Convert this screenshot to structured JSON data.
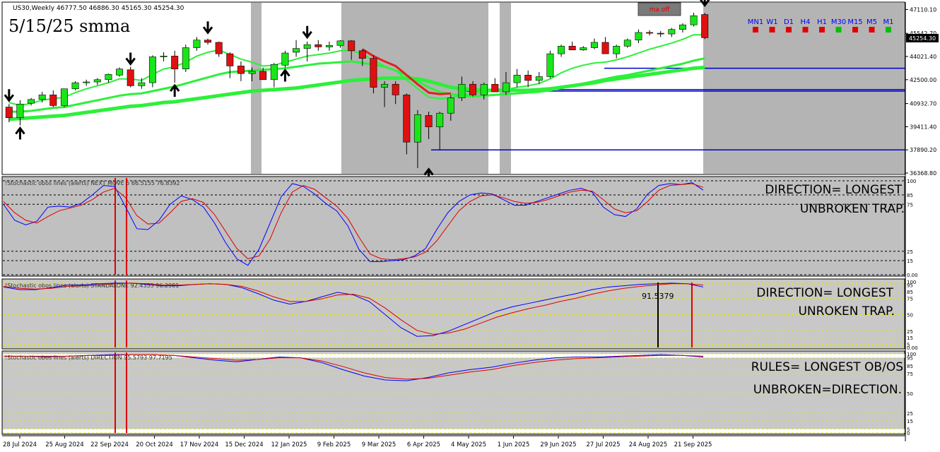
{
  "symbol_info": "US30,Weekly  46777.50 46886.30 45165.30 45254.30",
  "overlay_title": "5/15/25 smma",
  "ma_status_label": "ma off",
  "current_price_label": "45254.30",
  "timeframes": [
    {
      "label": "MN1",
      "color": "#e00000"
    },
    {
      "label": "W1",
      "color": "#e00000"
    },
    {
      "label": "D1",
      "color": "#e00000"
    },
    {
      "label": "H4",
      "color": "#e00000"
    },
    {
      "label": "H1",
      "color": "#e00000"
    },
    {
      "label": "M30",
      "color": "#00c000"
    },
    {
      "label": "M15",
      "color": "#e00000"
    },
    {
      "label": "M5",
      "color": "#e00000"
    },
    {
      "label": "M1",
      "color": "#00c000"
    }
  ],
  "x_axis_labels": [
    "28 Jul 2024",
    "25 Aug 2024",
    "22 Sep 2024",
    "20 Oct 2024",
    "17 Nov 2024",
    "15 Dec 2024",
    "12 Jan 2025",
    "9 Feb 2025",
    "9 Mar 2025",
    "6 Apr 2025",
    "4 May 2025",
    "1 Jun 2025",
    "29 Jun 2025",
    "27 Jul 2025",
    "24 Aug 2025",
    "21 Sep 2025"
  ],
  "subwindows": [
    {
      "label": "!Stochastic obos lines (alerts) NEXT MOVE 5 66.5155 76.8392",
      "note_lines": [
        "DIRECTION= LONGEST",
        "UNBROKEN TRAP."
      ],
      "levels": [
        "100",
        "85",
        "75",
        "25",
        "15",
        "0.00"
      ],
      "extra_levels": []
    },
    {
      "label": "!Stochastic obos lines (alerts) STANDALONE 92.4355 96.2981",
      "note_lines": [
        "DIRECTION= LONGEST",
        "UNROKEN TRAP."
      ],
      "levels": [
        "100",
        "95",
        "85",
        "75",
        "50",
        "25",
        "15",
        "5",
        "0.00"
      ],
      "extra_levels": [
        "99.5",
        "95"
      ],
      "annotation": "91.5379"
    },
    {
      "label": "!Stochastic obos lines (alerts) DIRECTION 95.5793 97.7195",
      "note_lines": [
        "RULES= LONGEST OB/OS",
        "UNBROKEN=DIRECTION."
      ],
      "levels": [
        "100",
        "95",
        "85",
        "75",
        "50",
        "25",
        "15",
        "5",
        "0"
      ],
      "extra_levels": []
    }
  ],
  "chart_data": [
    {
      "type": "candlestick",
      "title": "US30,Weekly",
      "ylim": [
        36368.8,
        47500
      ],
      "y_ticks": [
        "47110.10",
        "45542.70",
        "44021.40",
        "42500.00",
        "40932.70",
        "39411.40",
        "37890.20",
        "36368.80"
      ],
      "candles": [
        [
          40700,
          40900,
          39700,
          40000
        ],
        [
          40000,
          41150,
          39500,
          40900
        ],
        [
          40950,
          41300,
          40800,
          41200
        ],
        [
          41200,
          41700,
          41000,
          41500
        ],
        [
          41500,
          41800,
          40700,
          40800
        ],
        [
          40800,
          41900,
          40700,
          41900
        ],
        [
          41900,
          42400,
          41800,
          42300
        ],
        [
          42300,
          42500,
          42100,
          42350
        ],
        [
          42350,
          42600,
          42150,
          42500
        ],
        [
          42500,
          42900,
          42300,
          42850
        ],
        [
          42800,
          43300,
          42700,
          43200
        ],
        [
          43150,
          43350,
          42000,
          42100
        ],
        [
          42100,
          42600,
          41900,
          42300
        ],
        [
          42300,
          44100,
          42000,
          44000
        ],
        [
          44000,
          44300,
          43700,
          44050
        ],
        [
          44050,
          44400,
          42300,
          43200
        ],
        [
          43200,
          44800,
          43000,
          44600
        ],
        [
          44600,
          45300,
          44400,
          45100
        ],
        [
          45100,
          45200,
          44800,
          44950
        ],
        [
          44950,
          45000,
          44000,
          44200
        ],
        [
          44200,
          44300,
          42600,
          43400
        ],
        [
          43400,
          43700,
          42400,
          42900
        ],
        [
          42900,
          43300,
          42400,
          43050
        ],
        [
          43050,
          43300,
          42500,
          42500
        ],
        [
          42500,
          43600,
          42000,
          43500
        ],
        [
          43450,
          44400,
          43300,
          44250
        ],
        [
          44300,
          45100,
          44000,
          44550
        ],
        [
          44550,
          45000,
          43700,
          44800
        ],
        [
          44800,
          45100,
          44400,
          44650
        ],
        [
          44650,
          45000,
          44400,
          44750
        ],
        [
          44750,
          45100,
          44600,
          45050
        ],
        [
          45050,
          45100,
          43800,
          44400
        ],
        [
          44400,
          44500,
          43400,
          43900
        ],
        [
          43900,
          44100,
          41600,
          42000
        ],
        [
          42000,
          42400,
          40700,
          42200
        ],
        [
          42200,
          42400,
          40900,
          41500
        ],
        [
          41500,
          41600,
          37600,
          38400
        ],
        [
          38400,
          40500,
          36700,
          40200
        ],
        [
          40150,
          40400,
          38600,
          39400
        ],
        [
          39400,
          40400,
          37900,
          40300
        ],
        [
          40300,
          41500,
          39800,
          41300
        ],
        [
          41300,
          42700,
          41100,
          42200
        ],
        [
          42200,
          42400,
          41400,
          41500
        ],
        [
          41500,
          42300,
          41200,
          42200
        ],
        [
          42200,
          42600,
          41700,
          41700
        ],
        [
          41700,
          43000,
          41500,
          42300
        ],
        [
          42300,
          43200,
          42000,
          42800
        ],
        [
          42800,
          43100,
          42000,
          42450
        ],
        [
          42450,
          43000,
          42200,
          42700
        ],
        [
          42700,
          44400,
          42600,
          44200
        ],
        [
          44200,
          44800,
          44000,
          44700
        ],
        [
          44700,
          45000,
          44500,
          44450
        ],
        [
          44450,
          44700,
          44400,
          44600
        ],
        [
          44600,
          45200,
          44500,
          44950
        ],
        [
          44950,
          45300,
          44200,
          44200
        ],
        [
          44200,
          44800,
          43900,
          44700
        ],
        [
          44700,
          45200,
          44600,
          45100
        ],
        [
          45100,
          45800,
          44900,
          45600
        ],
        [
          45600,
          45750,
          45400,
          45550
        ],
        [
          45550,
          45700,
          45300,
          45500
        ],
        [
          45500,
          45900,
          45300,
          45800
        ],
        [
          45800,
          46200,
          45600,
          46100
        ],
        [
          46100,
          46900,
          46000,
          46700
        ],
        [
          46777.5,
          46886.3,
          45165.3,
          45254.3
        ]
      ],
      "smma_5": [
        41000,
        40800,
        40950,
        41150,
        41250,
        41350,
        41650,
        41900,
        42100,
        42300,
        42550,
        42550,
        42450,
        42850,
        43200,
        43350,
        43650,
        44050,
        44300,
        44450,
        44150,
        43850,
        43650,
        43400,
        43450,
        43650,
        43850,
        44050,
        44150,
        44250,
        44400,
        44400,
        44200,
        43750,
        43400,
        43100,
        42500,
        41900,
        41350,
        41250,
        41300,
        41500,
        41600,
        41650,
        41800,
        41850,
        42000,
        42100,
        42250,
        42550,
        42950,
        43250,
        43450,
        43600,
        43650,
        43800,
        44000,
        44250,
        44500,
        44700,
        44900,
        45150,
        45450,
        45450
      ],
      "smma_15": [
        40400,
        40400,
        40450,
        40550,
        40650,
        40700,
        40850,
        41000,
        41150,
        41300,
        41450,
        41550,
        41600,
        41750,
        41900,
        42050,
        42250,
        42450,
        42650,
        42850,
        43000,
        43050,
        43100,
        43150,
        43200,
        43250,
        43350,
        43450,
        43550,
        43600,
        43650,
        43700,
        43600,
        43500,
        43350,
        43100,
        42800,
        42400,
        42000,
        41700,
        41550,
        41450,
        41400,
        41450,
        41500,
        41550,
        41600,
        41650,
        41700,
        41800,
        41950,
        42100,
        42250,
        42400,
        42550,
        42700,
        42800,
        42950,
        43100,
        43250,
        43400,
        43550,
        43750,
        43900
      ],
      "smma_25": [
        39900,
        39950,
        40000,
        40050,
        40100,
        40150,
        40250,
        40350,
        40450,
        40550,
        40650,
        40750,
        40800,
        40900,
        41000,
        41050,
        41150,
        41250,
        41350,
        41450,
        41550,
        41650,
        41750,
        41800,
        41850,
        41900,
        41950,
        42050,
        42150,
        42250,
        42350,
        42450,
        42500,
        42550,
        42600,
        42600,
        42600,
        42550,
        42400,
        42200,
        42000,
        41900,
        41850,
        41800,
        41800,
        41800,
        41800,
        41800,
        41850,
        41900,
        42000,
        42100,
        42200,
        42300,
        42450,
        42550,
        42650,
        42750,
        42850,
        42950,
        43050,
        43150,
        43250,
        43300
      ],
      "horizontal_levels": [
        43250,
        41750,
        41850,
        37890
      ]
    },
    {
      "type": "line",
      "title": "NEXT MOVE 5",
      "ylim": [
        0,
        100
      ],
      "series": [
        {
          "name": "main",
          "color": "#0000ff",
          "values": [
            75,
            58,
            53,
            57,
            72,
            73,
            72,
            76,
            85,
            95,
            94,
            72,
            49,
            48,
            58,
            75,
            84,
            80,
            72,
            55,
            34,
            17,
            10,
            27,
            55,
            83,
            97,
            94,
            86,
            76,
            68,
            52,
            27,
            14,
            14,
            15,
            16,
            20,
            28,
            48,
            66,
            78,
            85,
            87,
            86,
            80,
            74,
            74,
            78,
            82,
            86,
            90,
            92,
            88,
            72,
            64,
            62,
            70,
            86,
            95,
            97,
            96,
            98,
            90
          ]
        },
        {
          "name": "signal",
          "color": "#e00000",
          "values": [
            78,
            66,
            58,
            55,
            62,
            68,
            71,
            74,
            80,
            88,
            92,
            82,
            63,
            54,
            55,
            66,
            78,
            81,
            77,
            64,
            46,
            28,
            17,
            20,
            38,
            66,
            88,
            95,
            91,
            82,
            73,
            60,
            40,
            22,
            17,
            16,
            17,
            19,
            24,
            36,
            52,
            68,
            78,
            84,
            85,
            82,
            78,
            76,
            77,
            80,
            84,
            88,
            90,
            89,
            80,
            70,
            66,
            68,
            78,
            90,
            95,
            96,
            97,
            93
          ]
        }
      ]
    },
    {
      "type": "line",
      "title": "STANDALONE",
      "ylim": [
        0,
        100
      ],
      "series": [
        {
          "name": "main",
          "color": "#0000ff",
          "values": [
            92,
            88,
            88,
            91,
            95,
            95,
            97,
            98,
            98,
            96,
            94,
            94,
            96,
            97,
            96,
            91,
            82,
            72,
            66,
            70,
            77,
            84,
            80,
            70,
            50,
            30,
            17,
            18,
            25,
            35,
            45,
            55,
            62,
            67,
            72,
            77,
            82,
            88,
            92,
            94,
            96,
            97,
            98,
            97,
            92
          ]
        },
        {
          "name": "signal",
          "color": "#e00000",
          "values": [
            93,
            90,
            89,
            90,
            93,
            94,
            95,
            97,
            98,
            97,
            95,
            95,
            96,
            97,
            96,
            93,
            86,
            77,
            70,
            70,
            74,
            80,
            81,
            75,
            60,
            42,
            26,
            20,
            22,
            28,
            37,
            46,
            53,
            59,
            64,
            70,
            75,
            81,
            86,
            90,
            93,
            95,
            97,
            97,
            95
          ]
        }
      ]
    },
    {
      "type": "line",
      "title": "DIRECTION",
      "ylim": [
        0,
        100
      ],
      "series": [
        {
          "name": "main",
          "color": "#0000ff",
          "values": [
            97,
            97,
            96,
            97,
            98,
            99,
            99,
            99,
            98,
            95,
            92,
            90,
            93,
            96,
            95,
            89,
            80,
            72,
            67,
            66,
            70,
            76,
            80,
            83,
            88,
            92,
            95,
            96,
            96,
            97,
            98,
            99,
            98,
            96
          ]
        },
        {
          "name": "signal",
          "color": "#e00000",
          "values": [
            97,
            97,
            97,
            97,
            98,
            98,
            99,
            99,
            98,
            96,
            94,
            92,
            93,
            95,
            95,
            91,
            84,
            76,
            70,
            68,
            69,
            73,
            77,
            80,
            85,
            89,
            92,
            94,
            95,
            96,
            97,
            98,
            98,
            97
          ]
        }
      ]
    }
  ]
}
